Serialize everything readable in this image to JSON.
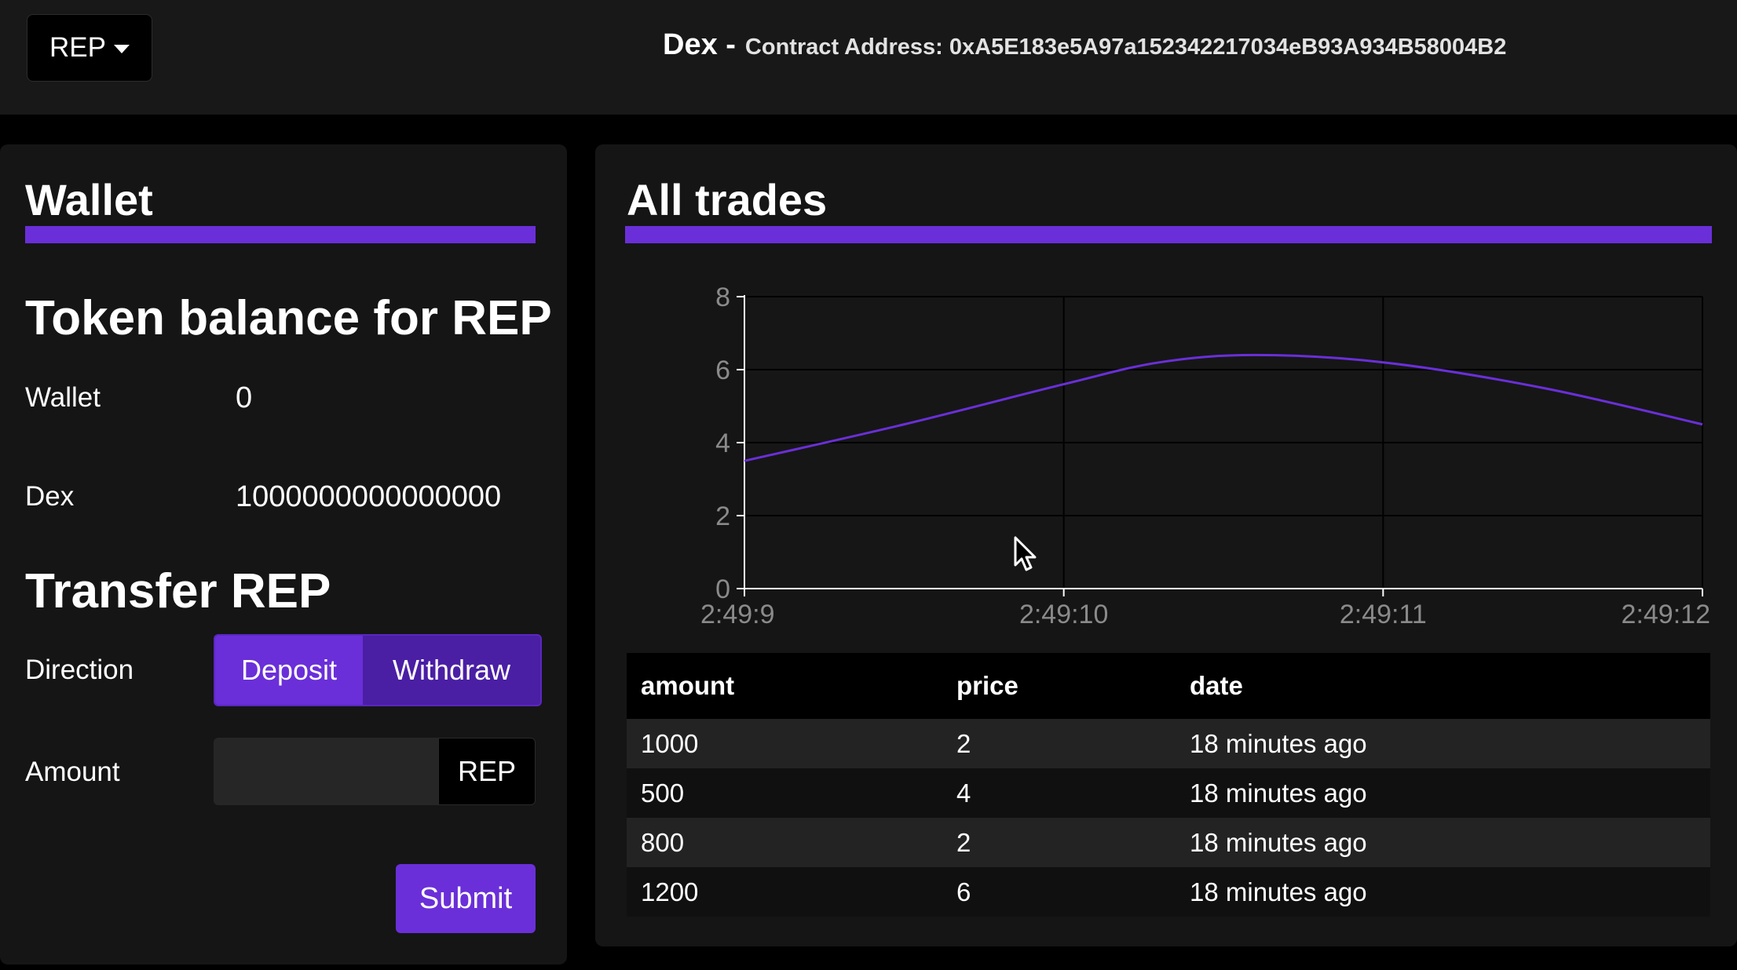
{
  "header": {
    "token_selector": "REP",
    "title": "Dex -",
    "contract_address": "Contract Address: 0xA5E183e5A97a152342217034eB93A934B58004B2"
  },
  "wallet": {
    "title": "Wallet",
    "balance_heading": "Token balance for REP",
    "rows": [
      {
        "label": "Wallet",
        "value": "0"
      },
      {
        "label": "Dex",
        "value": "1000000000000000"
      }
    ],
    "transfer_heading": "Transfer REP",
    "direction_label": "Direction",
    "direction_options": [
      "Deposit",
      "Withdraw"
    ],
    "direction_selected": "Deposit",
    "amount_label": "Amount",
    "amount_value": "",
    "amount_suffix": "REP",
    "submit_label": "Submit"
  },
  "trades": {
    "title": "All trades",
    "columns": [
      "amount",
      "price",
      "date"
    ],
    "rows": [
      {
        "amount": "1000",
        "price": "2",
        "date": "18 minutes ago"
      },
      {
        "amount": "500",
        "price": "4",
        "date": "18 minutes ago"
      },
      {
        "amount": "800",
        "price": "2",
        "date": "18 minutes ago"
      },
      {
        "amount": "1200",
        "price": "6",
        "date": "18 minutes ago"
      }
    ]
  },
  "colors": {
    "accent": "#6a2fd8",
    "line": "#6a2fd8",
    "background": "#000000",
    "panel": "#151515"
  },
  "cursor_icon": "mouse-pointer-icon",
  "chart_data": {
    "type": "line",
    "title": "",
    "xlabel": "",
    "ylabel": "",
    "x_ticks": [
      "2:49:9",
      "2:49:10",
      "2:49:11",
      "2:49:12"
    ],
    "y_ticks": [
      "0",
      "2",
      "4",
      "6",
      "8"
    ],
    "xlim": [
      0,
      3
    ],
    "ylim": [
      0,
      8
    ],
    "grid": true,
    "series": [
      {
        "x": [
          0,
          0.5,
          1,
          1.3,
          1.6,
          2,
          2.5,
          3
        ],
        "values": [
          3.5,
          4.5,
          5.6,
          6.2,
          6.4,
          6.2,
          5.5,
          4.5
        ]
      }
    ]
  }
}
